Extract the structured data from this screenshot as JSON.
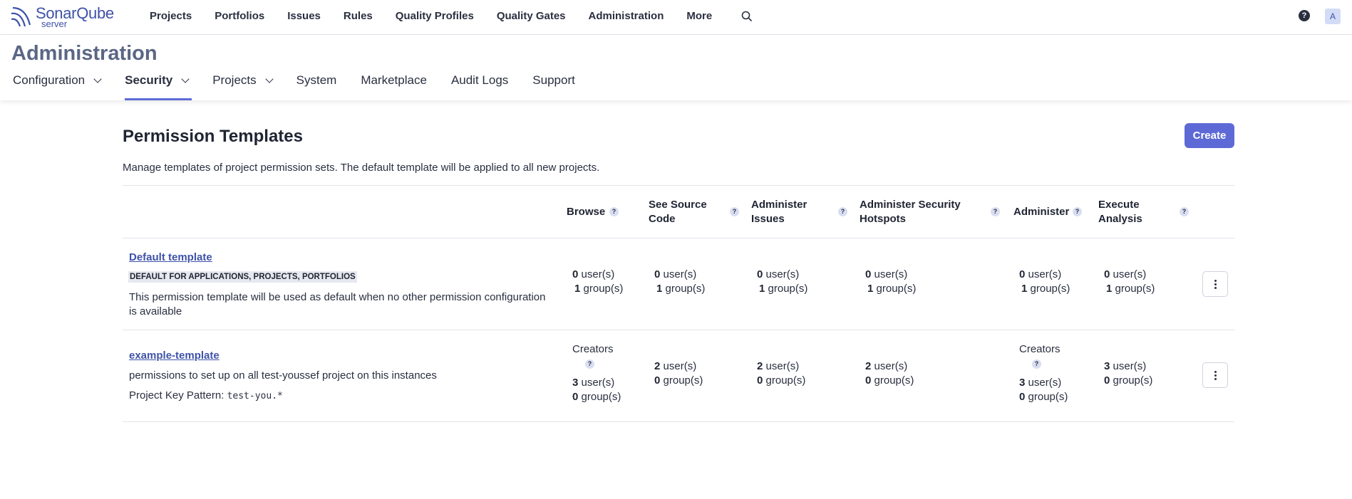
{
  "brand": {
    "name": "SonarQube",
    "sub": "server"
  },
  "topnav": {
    "items": [
      "Projects",
      "Portfolios",
      "Issues",
      "Rules",
      "Quality Profiles",
      "Quality Gates",
      "Administration",
      "More"
    ],
    "help": "?",
    "avatar": "A"
  },
  "admin": {
    "title": "Administration",
    "tabs": [
      "Configuration",
      "Security",
      "Projects",
      "System",
      "Marketplace",
      "Audit Logs",
      "Support"
    ],
    "active_tab": "Security"
  },
  "page": {
    "title": "Permission Templates",
    "create_label": "Create",
    "description": "Manage templates of project permission sets. The default template will be applied to all new projects."
  },
  "columns": [
    {
      "line1": "Browse",
      "line2": ""
    },
    {
      "line1": "See Source",
      "line2": "Code"
    },
    {
      "line1": "Administer",
      "line2": "Issues"
    },
    {
      "line1": "Administer Security",
      "line2": "Hotspots"
    },
    {
      "line1": "Administer",
      "line2": ""
    },
    {
      "line1": "Execute",
      "line2": "Analysis"
    }
  ],
  "templates": [
    {
      "name": "Default template",
      "badge": "DEFAULT FOR APPLICATIONS, PROJECTS, PORTFOLIOS",
      "desc_line1": "This permission template will be used as default when no other permission configuration",
      "desc_line2": "is available",
      "cells": [
        {
          "users": "0",
          "groups": "1"
        },
        {
          "users": "0",
          "groups": "1"
        },
        {
          "users": "0",
          "groups": "1"
        },
        {
          "users": "0",
          "groups": "1"
        },
        {
          "users": "0",
          "groups": "1"
        },
        {
          "users": "0",
          "groups": "1"
        }
      ]
    },
    {
      "name": "example-template",
      "desc": "permissions to set up on all test-youssef project on this instances",
      "key_pattern_label": "Project Key Pattern:",
      "key_pattern": "test-you.*",
      "cells": [
        {
          "creators": "Creators",
          "users": "3",
          "groups": "0"
        },
        {
          "users": "2",
          "groups": "0"
        },
        {
          "users": "2",
          "groups": "0"
        },
        {
          "users": "2",
          "groups": "0"
        },
        {
          "creators": "Creators",
          "users": "3",
          "groups": "0"
        },
        {
          "users": "3",
          "groups": "0"
        }
      ]
    }
  ],
  "labels": {
    "users": "user(s)",
    "groups": "group(s)",
    "q": "?"
  }
}
